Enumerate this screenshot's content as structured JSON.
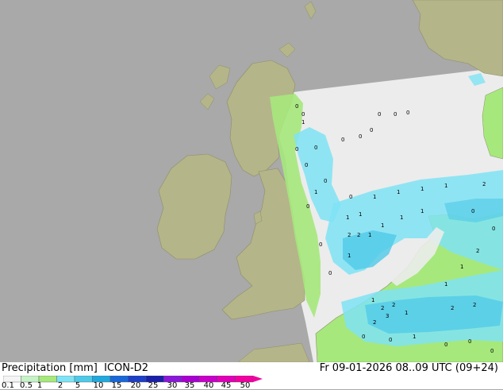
{
  "header": {
    "title_left": "Precipitation [mm]  ICON-D2",
    "title_right": "Fr 09-01-2026 08..09 UTC (09+24)"
  },
  "legend": {
    "labels": [
      "0.1",
      "0.5",
      "1",
      "2",
      "5",
      "10",
      "15",
      "20",
      "25",
      "30",
      "35",
      "40",
      "45",
      "50"
    ],
    "colors": [
      "#f5f5f5",
      "#c7f1c7",
      "#a6e87c",
      "#7fe3f5",
      "#4fc9e8",
      "#22a9dc",
      "#1a68d8",
      "#1e3fc7",
      "#1a20a8",
      "#8a18d8",
      "#a800d0",
      "#c800c8",
      "#e000b8",
      "#f000a0"
    ]
  },
  "map": {
    "colors": {
      "sea": "#a9a9a9",
      "land": "#b5b58a",
      "domain_background": "#ececec",
      "light_precip": "#c7f1c7",
      "lime_precip": "#a6e87c",
      "cyan_precip": "#7fe3f5",
      "blue_precip": "#4fc9e8"
    },
    "value_labels": [
      "0",
      "1",
      "2",
      "3"
    ]
  }
}
